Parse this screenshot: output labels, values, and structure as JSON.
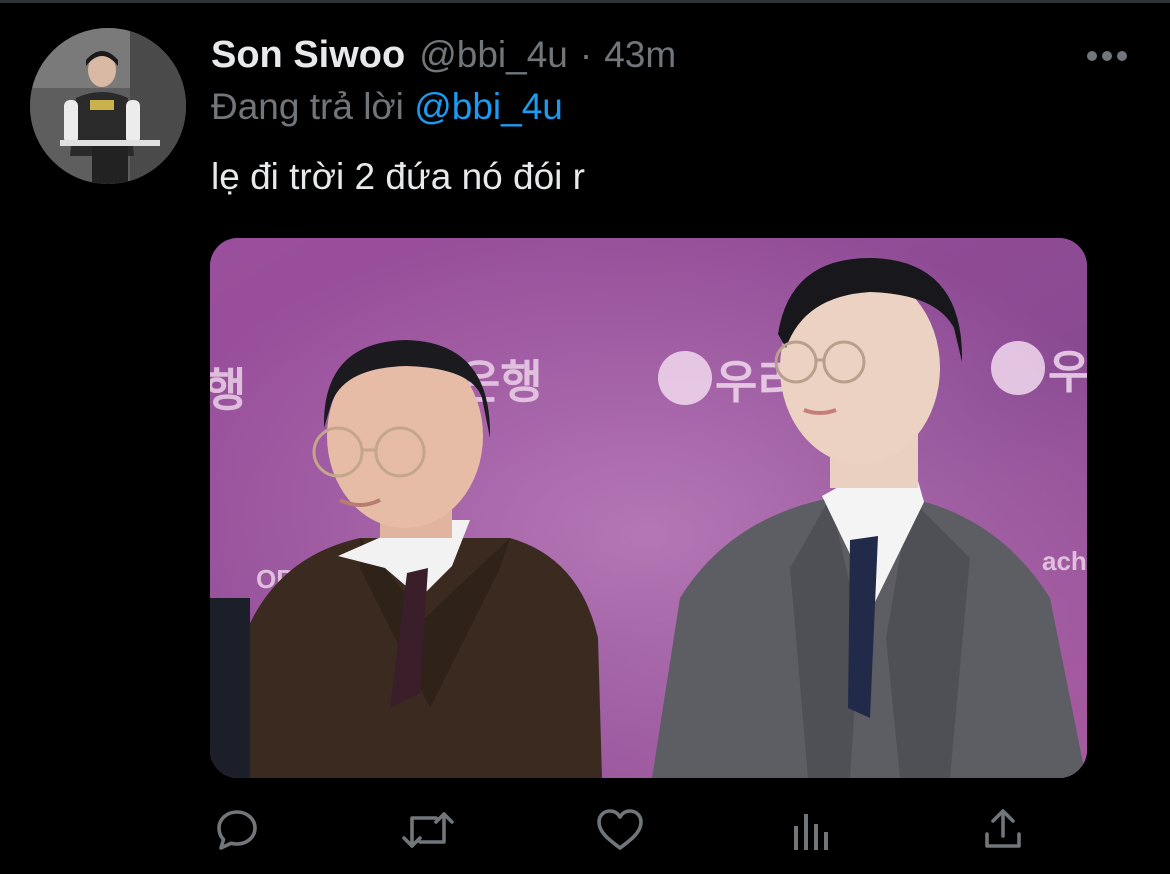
{
  "tweet": {
    "display_name": "Son Siwoo",
    "handle": "@bbi_4u",
    "separator": "·",
    "time": "43m",
    "reply_prefix": "Đang trả lời",
    "reply_to": "@bbi_4u",
    "text": "lẹ đi trời 2 đứa nó đói r"
  },
  "media": {
    "backdrop_texts": [
      "행",
      "은행",
      "우리",
      "우",
      "ORG",
      "ach"
    ]
  },
  "actions": [
    {
      "icon": "reply-icon"
    },
    {
      "icon": "retweet-icon"
    },
    {
      "icon": "like-icon"
    },
    {
      "icon": "analytics-icon"
    },
    {
      "icon": "share-icon"
    }
  ],
  "colors": {
    "background": "#000000",
    "text": "#e7e9ea",
    "secondary": "#71767b",
    "accent": "#1d9bf0"
  }
}
